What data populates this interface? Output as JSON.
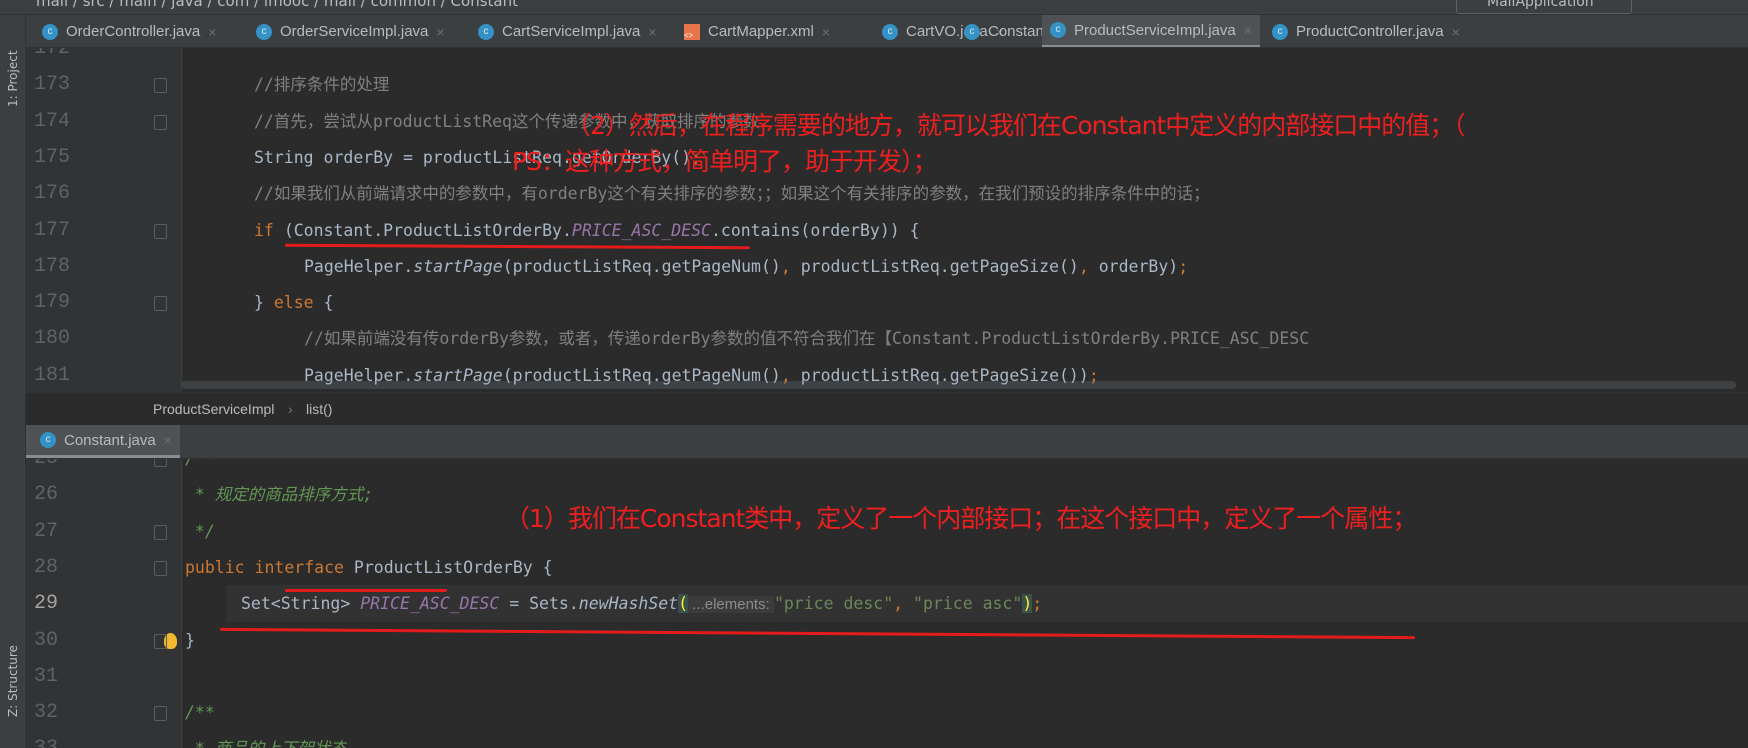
{
  "toolbar": {
    "breadcrumb": "mall / src / main / java / com / imooc / mall / common / Constant",
    "run_config": "MallApplication"
  },
  "tool_windows": {
    "project": "1: Project",
    "structure": "Z: Structure"
  },
  "tabs": [
    {
      "label": "OrderController.java",
      "icon": "class-icon"
    },
    {
      "label": "OrderServiceImpl.java",
      "icon": "class-icon"
    },
    {
      "label": "CartServiceImpl.java",
      "icon": "class-icon"
    },
    {
      "label": "CartMapper.xml",
      "icon": "xml-icon"
    },
    {
      "label": "CartVO.java",
      "icon": "class-icon"
    },
    {
      "label": "Constant.java",
      "icon": "class-icon"
    },
    {
      "label": "ProductServiceImpl.java",
      "icon": "class-icon",
      "active": true
    },
    {
      "label": "ProductController.java",
      "icon": "class-icon"
    }
  ],
  "top_editor": {
    "lines": [
      {
        "n": "172",
        "ind": 0,
        "seg": []
      },
      {
        "n": "173",
        "ind": 0,
        "seg": [
          {
            "t": "//排序条件的处理",
            "c": "com"
          }
        ]
      },
      {
        "n": "174",
        "ind": 0,
        "seg": [
          {
            "t": "//首先，尝试从productListReq这个传递参数中，获取排序的参数",
            "c": "com"
          }
        ]
      },
      {
        "n": "175",
        "ind": 0,
        "seg": [
          {
            "t": "String orderBy = productListReq.getOrderBy()"
          },
          {
            "t": ";",
            "c": "kw"
          }
        ]
      },
      {
        "n": "176",
        "ind": 0,
        "seg": [
          {
            "t": "//如果我们从前端请求中的参数中，有orderBy这个有关排序的参数；；如果这个有关排序的参数，在我们预设的排序条件中的话；",
            "c": "com"
          }
        ]
      },
      {
        "n": "177",
        "ind": 0,
        "seg": [
          {
            "t": "if ",
            "c": "kw"
          },
          {
            "t": "(Constant.ProductListOrderBy."
          },
          {
            "t": "PRICE_ASC_DESC",
            "c": "const"
          },
          {
            "t": ".contains(orderBy)) {"
          }
        ]
      },
      {
        "n": "178",
        "ind": 1,
        "seg": [
          {
            "t": "PageHelper."
          },
          {
            "t": "startPage",
            "c": "it"
          },
          {
            "t": "(productListReq.getPageNum()"
          },
          {
            "t": ", ",
            "c": "kw"
          },
          {
            "t": "productListReq.getPageSize()"
          },
          {
            "t": ", ",
            "c": "kw"
          },
          {
            "t": "orderBy)"
          },
          {
            "t": ";",
            "c": "kw"
          }
        ]
      },
      {
        "n": "179",
        "ind": 0,
        "seg": [
          {
            "t": "} "
          },
          {
            "t": "else ",
            "c": "kw"
          },
          {
            "t": "{"
          }
        ]
      },
      {
        "n": "180",
        "ind": 1,
        "seg": [
          {
            "t": "//如果前端没有传orderBy参数，或者，传递orderBy参数的值不符合我们在【Constant.ProductListOrderBy.PRICE_ASC_DESC",
            "c": "com"
          }
        ]
      },
      {
        "n": "181",
        "ind": 1,
        "seg": [
          {
            "t": "PageHelper."
          },
          {
            "t": "startPage",
            "c": "it"
          },
          {
            "t": "(productListReq.getPageNum()"
          },
          {
            "t": ", ",
            "c": "kw"
          },
          {
            "t": "productListReq.getPageSize())"
          },
          {
            "t": ";",
            "c": "kw"
          }
        ]
      }
    ]
  },
  "breadcrumb": {
    "class": "ProductServiceImpl",
    "method": "list()"
  },
  "bottom_tab": {
    "label": "Constant.java"
  },
  "bottom_editor": {
    "lines": [
      {
        "n": "25",
        "ind": 0,
        "seg": [
          {
            "t": "/**",
            "c": "doc"
          }
        ]
      },
      {
        "n": "26",
        "ind": 0,
        "seg": [
          {
            "t": " * 规定的商品排序方式;",
            "c": "doc"
          }
        ]
      },
      {
        "n": "27",
        "ind": 0,
        "seg": [
          {
            "t": " */",
            "c": "doc"
          }
        ]
      },
      {
        "n": "28",
        "ind": 0,
        "seg": [
          {
            "t": "public interface ",
            "c": "kw"
          },
          {
            "t": "ProductListOrderBy {"
          }
        ]
      },
      {
        "n": "29",
        "ind": 1,
        "cur": true,
        "seg": [
          {
            "t": "Set<String> "
          },
          {
            "t": "PRICE_ASC_DESC",
            "c": "const"
          },
          {
            "t": " = Sets."
          },
          {
            "t": "newHashSet",
            "c": "it"
          },
          {
            "t": "(",
            "c": "brace"
          },
          {
            "t": " ...elements: ",
            "c": "hint"
          },
          {
            "t": "\"price desc\"",
            "c": "str"
          },
          {
            "t": ", ",
            "c": "kw"
          },
          {
            "t": "\"price asc\"",
            "c": "str"
          },
          {
            "t": ")",
            "c": "brace"
          },
          {
            "t": ";",
            "c": "kw"
          }
        ]
      },
      {
        "n": "30",
        "ind": 0,
        "seg": [
          {
            "t": "}"
          }
        ]
      },
      {
        "n": "31",
        "ind": 0,
        "seg": []
      },
      {
        "n": "32",
        "ind": 0,
        "seg": [
          {
            "t": "/**",
            "c": "doc"
          }
        ]
      },
      {
        "n": "33",
        "ind": 0,
        "seg": [
          {
            "t": " * 商品的上下架状态",
            "c": "doc"
          }
        ]
      }
    ]
  },
  "annotations": {
    "note2_line1": "（2）然后，在程序需要的地方，就可以我们在Constant中定义的内部接口中的值；（",
    "note2_line2": "PS：这种方式，简单明了，助于开发）；",
    "note1": "（1）我们在Constant类中，定义了一个内部接口；在这个接口中，定义了一个属性；",
    "color": "#f01f1f"
  }
}
